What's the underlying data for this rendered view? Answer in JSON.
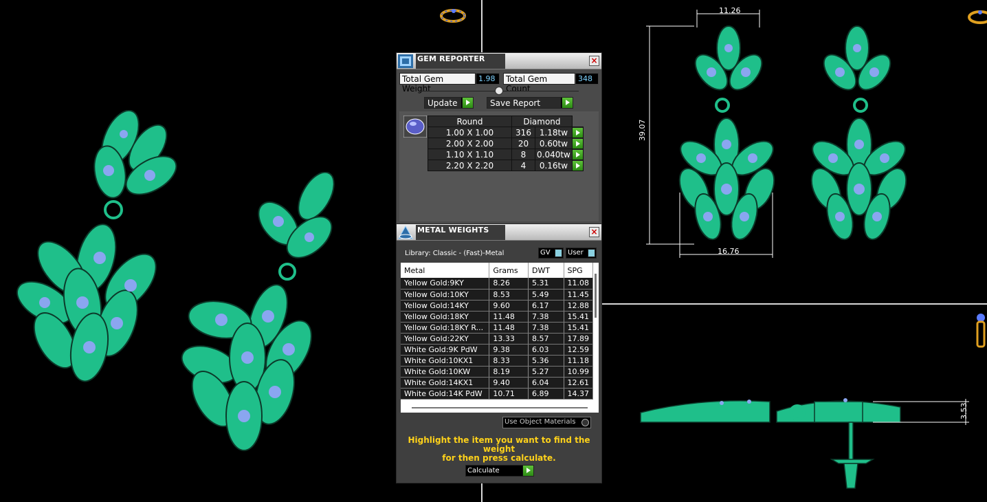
{
  "gem_reporter": {
    "title": "GEM REPORTER",
    "total_weight_label": "Total Gem Weight",
    "total_weight_value": "1.98",
    "total_count_label": "Total Gem Count",
    "total_count_value": "348",
    "update_label": "Update",
    "save_label": "Save Report",
    "headers": {
      "shape": "Round",
      "type": "Diamond"
    },
    "rows": [
      {
        "size": "1.00 X 1.00",
        "count": "316",
        "weight": "1.18tw"
      },
      {
        "size": "2.00 X 2.00",
        "count": "20",
        "weight": "0.60tw"
      },
      {
        "size": "1.10 X 1.10",
        "count": "8",
        "weight": "0.040tw"
      },
      {
        "size": "2.20 X 2.20",
        "count": "4",
        "weight": "0.16tw"
      }
    ]
  },
  "metal_weights": {
    "title": "METAL WEIGHTS",
    "library": "Library: Classic - (Fast)-Metal",
    "gv_label": "GV",
    "user_label": "User",
    "columns": [
      "Metal",
      "Grams",
      "DWT",
      "SPG"
    ],
    "rows": [
      [
        "Yellow Gold:9KY",
        "8.26",
        "5.31",
        "11.08"
      ],
      [
        "Yellow Gold:10KY",
        "8.53",
        "5.49",
        "11.45"
      ],
      [
        "Yellow Gold:14KY",
        "9.60",
        "6.17",
        "12.88"
      ],
      [
        "Yellow Gold:18KY",
        "11.48",
        "7.38",
        "15.41"
      ],
      [
        "Yellow Gold:18KY R...",
        "11.48",
        "7.38",
        "15.41"
      ],
      [
        "Yellow Gold:22KY",
        "13.33",
        "8.57",
        "17.89"
      ],
      [
        "White Gold:9K PdW",
        "9.38",
        "6.03",
        "12.59"
      ],
      [
        "White Gold:10KX1",
        "8.33",
        "5.36",
        "11.18"
      ],
      [
        "White Gold:10KW",
        "8.19",
        "5.27",
        "10.99"
      ],
      [
        "White Gold:14KX1",
        "9.40",
        "6.04",
        "12.61"
      ],
      [
        "White Gold:14K PdW",
        "10.71",
        "6.89",
        "14.37"
      ]
    ],
    "use_object_label": "Use Object Materials",
    "hint_line1": "Highlight the item you want to find the weight",
    "hint_line2": "for then press calculate.",
    "calculate_label": "Calculate"
  },
  "dimensions": {
    "width_top": "11.26",
    "height": "39.07",
    "width_bottom": "16.76",
    "side_height": "3.53"
  },
  "colors": {
    "metal": "#1fbf8a",
    "gem": "#8aa6f0",
    "accent_text": "#ffd21a",
    "panel": "#4a4a4a"
  }
}
